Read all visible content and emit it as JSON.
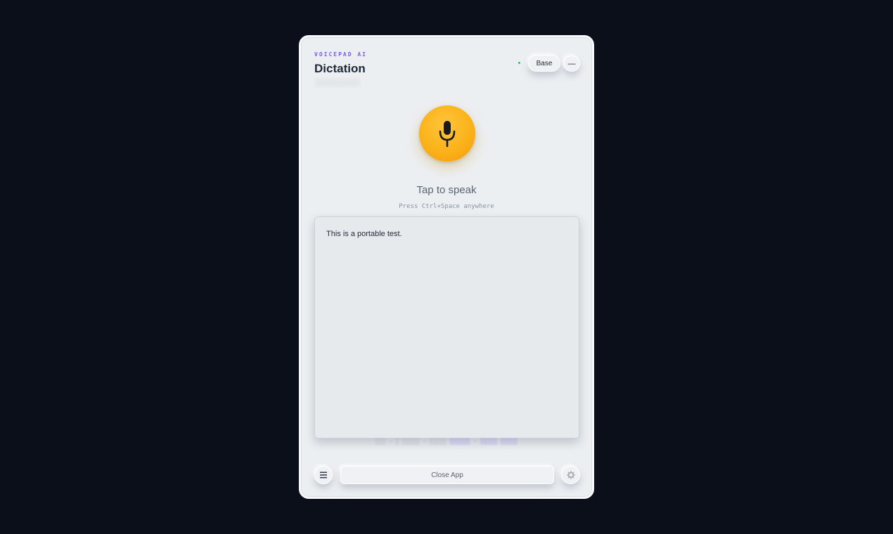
{
  "header": {
    "eyebrow": "VOICEPAD AI",
    "title": "Dictation"
  },
  "toolbar": {
    "model_label": "Base",
    "minimize_label": "—"
  },
  "recorder": {
    "tap_label": "Tap to speak",
    "hint": "Press Ctrl+Space anywhere"
  },
  "editor": {
    "text": "This is a portable test."
  },
  "footer": {
    "close_label": "Close App",
    "menu_icon": "hamburger-icon",
    "settings_icon": "gear-icon"
  },
  "colors": {
    "accent": "#7a5af0",
    "mic": "#fbb21a",
    "status": "#22c55e"
  }
}
